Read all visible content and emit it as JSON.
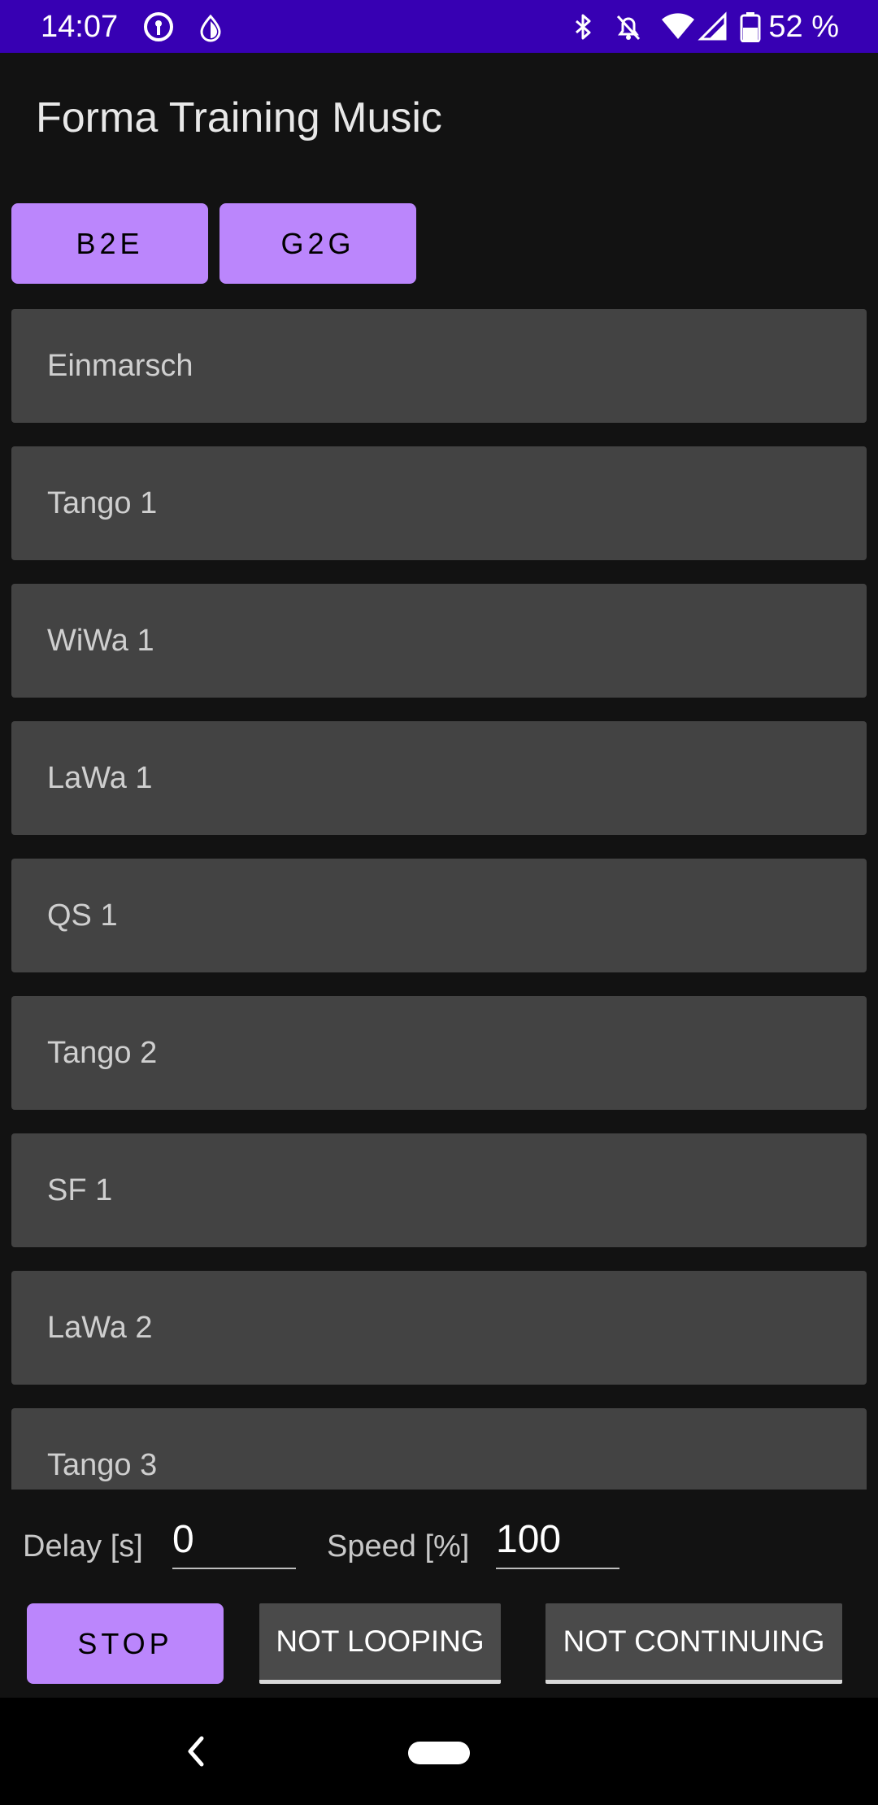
{
  "status_bar": {
    "time": "14:07",
    "battery": "52 %",
    "icons": [
      "vpn-key-icon",
      "data-saver-icon",
      "bluetooth-icon",
      "notifications-off-icon",
      "wifi-icon",
      "cell-signal-icon",
      "battery-icon"
    ],
    "color": "#3700b3"
  },
  "app": {
    "title": "Forma Training Music"
  },
  "modes": [
    {
      "label": "B2E"
    },
    {
      "label": "G2G"
    }
  ],
  "tracks": [
    {
      "label": "Einmarsch"
    },
    {
      "label": "Tango 1"
    },
    {
      "label": "WiWa 1"
    },
    {
      "label": "LaWa 1"
    },
    {
      "label": "QS 1"
    },
    {
      "label": "Tango 2"
    },
    {
      "label": "SF 1"
    },
    {
      "label": "LaWa 2"
    },
    {
      "label": "Tango 3"
    }
  ],
  "controls": {
    "delay_label": "Delay [s]",
    "delay_value": "0",
    "speed_label": "Speed [%]",
    "speed_value": "100"
  },
  "buttons": {
    "stop": "STOP",
    "looping": "NOT LOOPING",
    "continuing": "NOT CONTINUING"
  },
  "theme": {
    "accent": "#bb86fc",
    "background": "#121212",
    "item_background": "#434343"
  }
}
